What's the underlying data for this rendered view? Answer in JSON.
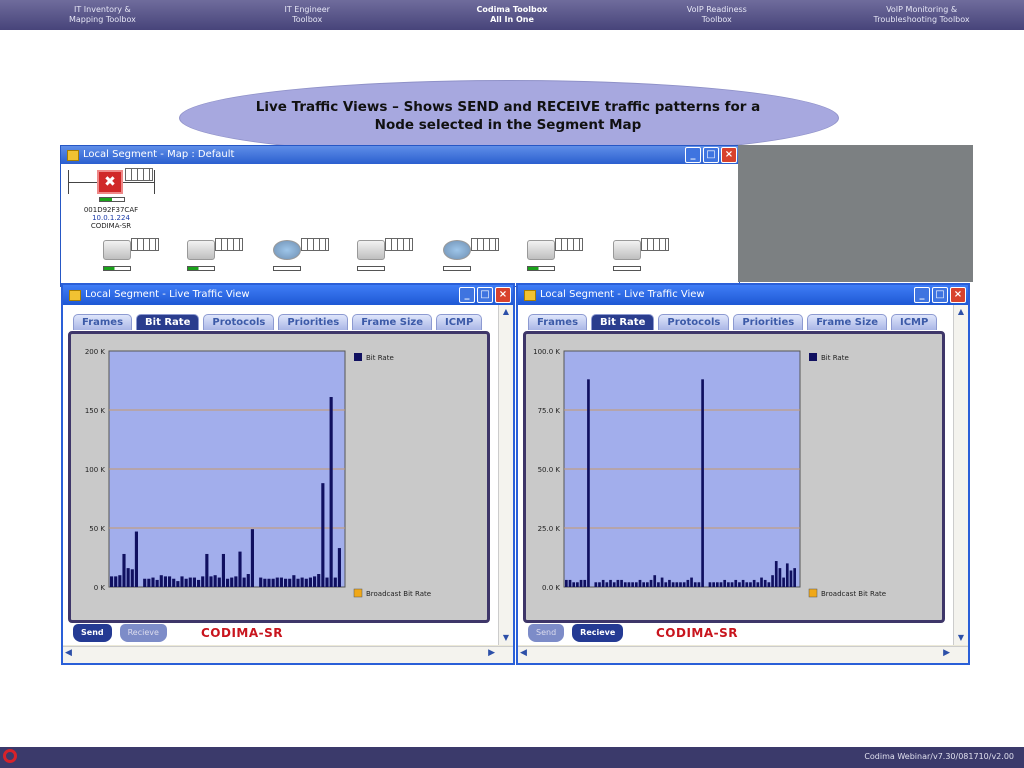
{
  "nav": {
    "items": [
      {
        "line1": "IT Inventory &",
        "line2": "Mapping Toolbox",
        "active": false
      },
      {
        "line1": "IT Engineer",
        "line2": "Toolbox",
        "active": false
      },
      {
        "line1": "Codima Toolbox",
        "line2": "All In One",
        "active": true
      },
      {
        "line1": "VoIP Readiness",
        "line2": "Toolbox",
        "active": false
      },
      {
        "line1": "VoIP Monitoring &",
        "line2": "Troubleshooting Toolbox",
        "active": false
      }
    ]
  },
  "callout": {
    "line1": "Live Traffic Views – Shows SEND and RECEIVE traffic patterns for a",
    "line2": "Node selected in the Segment Map"
  },
  "map_window": {
    "title": "Local Segment - Map : Default",
    "main_node": {
      "id": "001D92F37CAF",
      "ip": "10.0.1.224",
      "name": "CODIMA-SR"
    }
  },
  "live_windows": [
    {
      "title": "Local Segment - Live Traffic View",
      "tabs": [
        "Frames",
        "Bit Rate",
        "Protocols",
        "Priorities",
        "Frame Size",
        "ICMP"
      ],
      "active_tab": "Bit Rate",
      "send_label": "Send",
      "receive_label": "Recieve",
      "active_button": "Send",
      "node_label": "CODIMA-SR"
    },
    {
      "title": "Local Segment - Live Traffic View",
      "tabs": [
        "Frames",
        "Bit Rate",
        "Protocols",
        "Priorities",
        "Frame Size",
        "ICMP"
      ],
      "active_tab": "Bit Rate",
      "send_label": "Send",
      "receive_label": "Recieve",
      "active_button": "Recieve",
      "node_label": "CODIMA-SR"
    }
  ],
  "chart_data": [
    {
      "type": "bar",
      "ylim": [
        0,
        200000
      ],
      "yticks": [
        "200 K",
        "150 K",
        "100 K",
        "50 K",
        "0 K"
      ],
      "grid": true,
      "legend_position": "right",
      "series": [
        {
          "name": "Bit Rate",
          "color": "#101060",
          "values": [
            9000,
            9000,
            10000,
            28000,
            16000,
            15000,
            47000,
            0,
            7000,
            7000,
            8000,
            6000,
            10000,
            9000,
            9000,
            7000,
            5000,
            9000,
            7000,
            8000,
            8000,
            6000,
            9000,
            28000,
            9000,
            10000,
            8000,
            28000,
            7000,
            8000,
            9000,
            30000,
            8000,
            11000,
            49000,
            0,
            8000,
            7000,
            7000,
            7000,
            8000,
            8000,
            7000,
            7000,
            10000,
            7000,
            8000,
            7000,
            8000,
            9000,
            11000,
            88000,
            8000,
            161000,
            8000,
            33000
          ]
        },
        {
          "name": "Broadcast Bit Rate",
          "color": "#f0a818",
          "values": []
        }
      ]
    },
    {
      "type": "bar",
      "ylim": [
        0,
        100000
      ],
      "yticks": [
        "100.0 K",
        "75.0 K",
        "50.0 K",
        "25.0 K",
        "0.0 K"
      ],
      "grid": true,
      "legend_position": "right",
      "series": [
        {
          "name": "Bit Rate",
          "color": "#101060",
          "values": [
            3000,
            3000,
            2000,
            2000,
            3000,
            3000,
            88000,
            0,
            2000,
            2000,
            3000,
            2000,
            3000,
            2000,
            3000,
            3000,
            2000,
            2000,
            2000,
            2000,
            3000,
            2000,
            2000,
            3000,
            5000,
            2000,
            4000,
            2000,
            3000,
            2000,
            2000,
            2000,
            2000,
            3000,
            4000,
            2000,
            2000,
            88000,
            0,
            2000,
            2000,
            2000,
            2000,
            3000,
            2000,
            2000,
            3000,
            2000,
            3000,
            2000,
            2000,
            3000,
            2000,
            4000,
            3000,
            2000,
            5000,
            11000,
            8000,
            4000,
            10000,
            7000,
            8000
          ]
        },
        {
          "name": "Broadcast Bit Rate",
          "color": "#f0a818",
          "values": []
        }
      ]
    }
  ],
  "footer": {
    "text": "Codima Webinar/v7.30/081710/v2.00"
  }
}
